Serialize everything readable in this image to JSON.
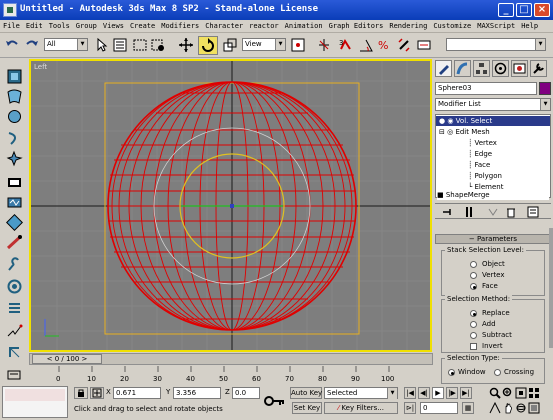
{
  "window": {
    "title": "Untitled - Autodesk 3ds Max 8 SP2 - Stand-alone License"
  },
  "menu": [
    "File",
    "Edit",
    "Tools",
    "Group",
    "Views",
    "Create",
    "Modifiers",
    "Character",
    "reactor",
    "Animation",
    "Graph Editors",
    "Rendering",
    "Customize",
    "MAXScript",
    "Help"
  ],
  "toolbar": {
    "selection_filter": "All",
    "reference_coord": "View"
  },
  "viewport": {
    "label": "Left"
  },
  "command_panel": {
    "object_name": "Sphere03",
    "object_color": "#800080",
    "modifier_list": "Modifier List",
    "stack": {
      "vol_select": "Vol. Select",
      "edit_mesh": "Edit Mesh",
      "sub": [
        "Vertex",
        "Edge",
        "Face",
        "Polygon",
        "Element"
      ],
      "shape_merge": "ShapeMerge"
    },
    "rollout_title": "Parameters",
    "stack_level": {
      "title": "Stack Selection Level:",
      "options": [
        "Object",
        "Vertex",
        "Face"
      ],
      "selected": "Face"
    },
    "selection_method": {
      "title": "Selection Method:",
      "options": [
        "Replace",
        "Add",
        "Subtract"
      ],
      "selected": "Replace",
      "invert": "Invert"
    },
    "selection_type": {
      "title": "Selection Type:",
      "window": "Window",
      "crossing": "Crossing"
    }
  },
  "timeline": {
    "frame_display": "0 / 100",
    "ticks": [
      "0",
      "10",
      "20",
      "30",
      "40",
      "50",
      "60",
      "70",
      "80",
      "90",
      "100"
    ]
  },
  "status": {
    "x_label": "X",
    "x_value": "0.671",
    "y_label": "Y",
    "y_value": "3.356",
    "z_label": "Z",
    "z_value": "0.0",
    "auto_key": "Auto Key",
    "set_key": "Set Key",
    "key_mode": "Selected",
    "key_filters": "Key Filters...",
    "prompt": "Click and drag to select and rotate objects",
    "current_frame": "0"
  },
  "colors": {
    "wire": "#e00000",
    "viewport_border": "#f0e000",
    "title_bar": "#0a3db8"
  }
}
